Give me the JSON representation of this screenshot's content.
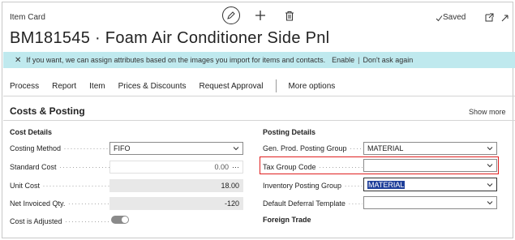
{
  "header": {
    "caption": "Item Card",
    "saved_label": "Saved",
    "title": "BM181545 · Foam Air Conditioner Side Pnl"
  },
  "notification": {
    "message": "If you want, we can assign attributes based on the images you import for items and contacts.",
    "enable": "Enable",
    "separator": "|",
    "dont_ask": "Don't ask again"
  },
  "actions": {
    "items": [
      "Process",
      "Report",
      "Item",
      "Prices & Discounts",
      "Request Approval"
    ],
    "more": "More options"
  },
  "section": {
    "title": "Costs & Posting",
    "show_more": "Show more"
  },
  "cost_details": {
    "heading": "Cost Details",
    "costing_method": {
      "label": "Costing Method",
      "value": "FIFO"
    },
    "standard_cost": {
      "label": "Standard Cost",
      "value": "0.00",
      "ellipsis": "···"
    },
    "unit_cost": {
      "label": "Unit Cost",
      "value": "18.00"
    },
    "net_invoiced_qty": {
      "label": "Net Invoiced Qty.",
      "value": "-120"
    },
    "cost_is_adjusted": {
      "label": "Cost is Adjusted",
      "on": true
    }
  },
  "posting_details": {
    "heading": "Posting Details",
    "gen_prod_posting_group": {
      "label": "Gen. Prod. Posting Group",
      "value": "MATERIAL"
    },
    "tax_group_code": {
      "label": "Tax Group Code",
      "value": ""
    },
    "inventory_posting_group": {
      "label": "Inventory Posting Group",
      "value": "MATERIAL"
    },
    "default_deferral_template": {
      "label": "Default Deferral Template",
      "value": ""
    },
    "foreign_trade_heading": "Foreign Trade"
  },
  "colors": {
    "notification_bg": "#bfe9ee",
    "highlight_red": "#e02020",
    "selection": "#1f3f9a"
  }
}
